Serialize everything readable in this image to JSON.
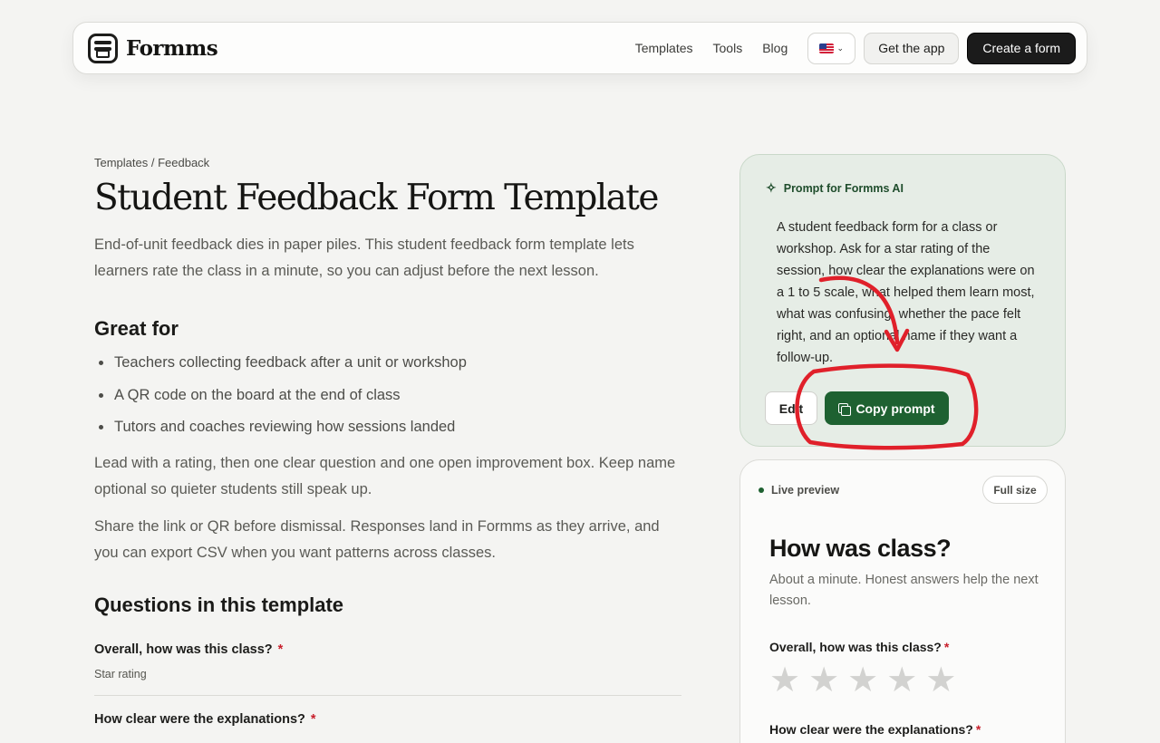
{
  "nav": {
    "brand": "Formms",
    "links": [
      "Templates",
      "Tools",
      "Blog"
    ],
    "get_app": "Get the app",
    "create_form": "Create a form"
  },
  "breadcrumb": {
    "root": "Templates",
    "separator": " / ",
    "current": "Feedback"
  },
  "page": {
    "title": "Student Feedback Form Template",
    "intro": "End-of-unit feedback dies in paper piles. This student feedback form template lets learners rate the class in a minute, so you can adjust before the next lesson.",
    "great_for_heading": "Great for",
    "great_for": [
      "Teachers collecting feedback after a unit or workshop",
      "A QR code on the board at the end of class",
      "Tutors and coaches reviewing how sessions landed"
    ],
    "para1": "Lead with a rating, then one clear question and one open improvement box. Keep name optional so quieter students still speak up.",
    "para2": "Share the link or QR before dismissal. Responses land in Formms as they arrive, and you can export CSV when you want patterns across classes.",
    "questions_heading": "Questions in this template",
    "questions": [
      {
        "title": "Overall, how was this class?",
        "required": "*",
        "type": "Star rating"
      },
      {
        "title": "How clear were the explanations?",
        "required": "*",
        "type": ""
      }
    ]
  },
  "prompt": {
    "heading": "Prompt for Formms AI",
    "text": "A student feedback form for a class or workshop. Ask for a star rating of the session, how clear the explanations were on a 1 to 5 scale, what helped them learn most, what was confusing, whether the pace felt right, and an optional name if they want a follow-up.",
    "edit_label": "Edit",
    "copy_label": "Copy prompt"
  },
  "preview": {
    "live_label": "Live preview",
    "full_size": "Full size",
    "title": "How was class?",
    "subtitle": "About a minute. Honest answers help the next lesson.",
    "q1": "Overall, how was this class?",
    "q2": "How clear were the explanations?",
    "required": "*",
    "star_count": 5
  },
  "colors": {
    "accent_green": "#1e6131",
    "annotation_red": "#e0202a",
    "required_red": "#c8202c"
  }
}
